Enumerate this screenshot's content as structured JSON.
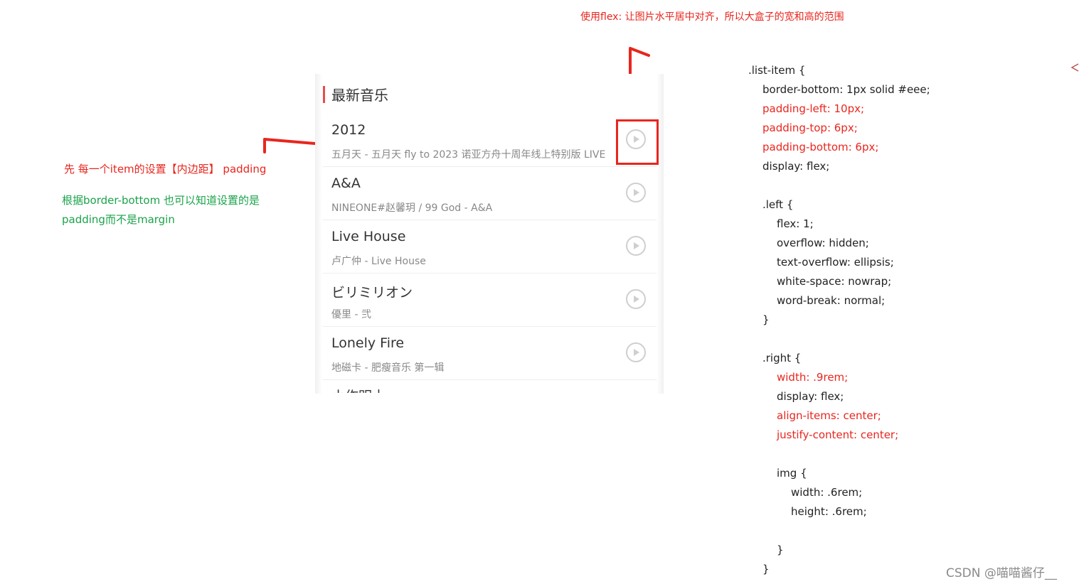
{
  "annotations": {
    "top_note": "使用flex: 让图片水平居中对齐，所以大盒子的宽和高的范围",
    "left_note_red": "先 每一个item的设置【内边距】 padding",
    "left_note_green_line1": "根据border-bottom 也可以知道设置的是",
    "left_note_green_line2": "padding而不是margin"
  },
  "panel": {
    "section_title": "最新音乐",
    "songs": [
      {
        "title": "2012",
        "subtitle": "五月天 - 五月天 fly to 2023 诺亚方舟十周年线上特别版 LIVE"
      },
      {
        "title": "A&A",
        "subtitle": "NINEONE#赵馨玥 / 99 God - A&A"
      },
      {
        "title": "Live House",
        "subtitle": "卢广仲 - Live House"
      },
      {
        "title": "ビリミリオン",
        "subtitle": "優里 - 弐"
      },
      {
        "title": "Lonely Fire",
        "subtitle": "地磁卡 - 肥瘦音乐 第一辑"
      }
    ],
    "partial_title": "小作明士"
  },
  "code": [
    {
      "text": ".list-item {",
      "indent": 0,
      "red": false
    },
    {
      "text": "border-bottom: 1px solid #eee;",
      "indent": 1,
      "red": false
    },
    {
      "text": "padding-left: 10px;",
      "indent": 1,
      "red": true
    },
    {
      "text": "padding-top: 6px;",
      "indent": 1,
      "red": true
    },
    {
      "text": "padding-bottom: 6px;",
      "indent": 1,
      "red": true
    },
    {
      "text": "display: flex;",
      "indent": 1,
      "red": false
    },
    {
      "text": "",
      "indent": 0,
      "red": false
    },
    {
      "text": ".left {",
      "indent": 1,
      "red": false
    },
    {
      "text": "flex: 1;",
      "indent": 2,
      "red": false
    },
    {
      "text": "overflow: hidden;",
      "indent": 2,
      "red": false
    },
    {
      "text": "text-overflow: ellipsis;",
      "indent": 2,
      "red": false
    },
    {
      "text": "white-space: nowrap;",
      "indent": 2,
      "red": false
    },
    {
      "text": "word-break: normal;",
      "indent": 2,
      "red": false
    },
    {
      "text": "}",
      "indent": 1,
      "red": false
    },
    {
      "text": "",
      "indent": 0,
      "red": false
    },
    {
      "text": ".right {",
      "indent": 1,
      "red": false
    },
    {
      "text": "width: .9rem;",
      "indent": 2,
      "red": true
    },
    {
      "text": "display: flex;",
      "indent": 2,
      "red": false
    },
    {
      "text": "align-items: center;",
      "indent": 2,
      "red": true
    },
    {
      "text": "justify-content: center;",
      "indent": 2,
      "red": true
    },
    {
      "text": "",
      "indent": 0,
      "red": false
    },
    {
      "text": "img {",
      "indent": 2,
      "red": false
    },
    {
      "text": "width: .6rem;",
      "indent": 3,
      "red": false
    },
    {
      "text": "height: .6rem;",
      "indent": 3,
      "red": false
    },
    {
      "text": "",
      "indent": 0,
      "red": false
    },
    {
      "text": "}",
      "indent": 2,
      "red": false
    },
    {
      "text": "}",
      "indent": 1,
      "red": false
    }
  ],
  "watermark": "CSDN @喵喵酱仔__",
  "colors": {
    "annotation_red": "#e8261e",
    "annotation_green": "#1aa34a",
    "accent_bar": "#e84c4c"
  }
}
